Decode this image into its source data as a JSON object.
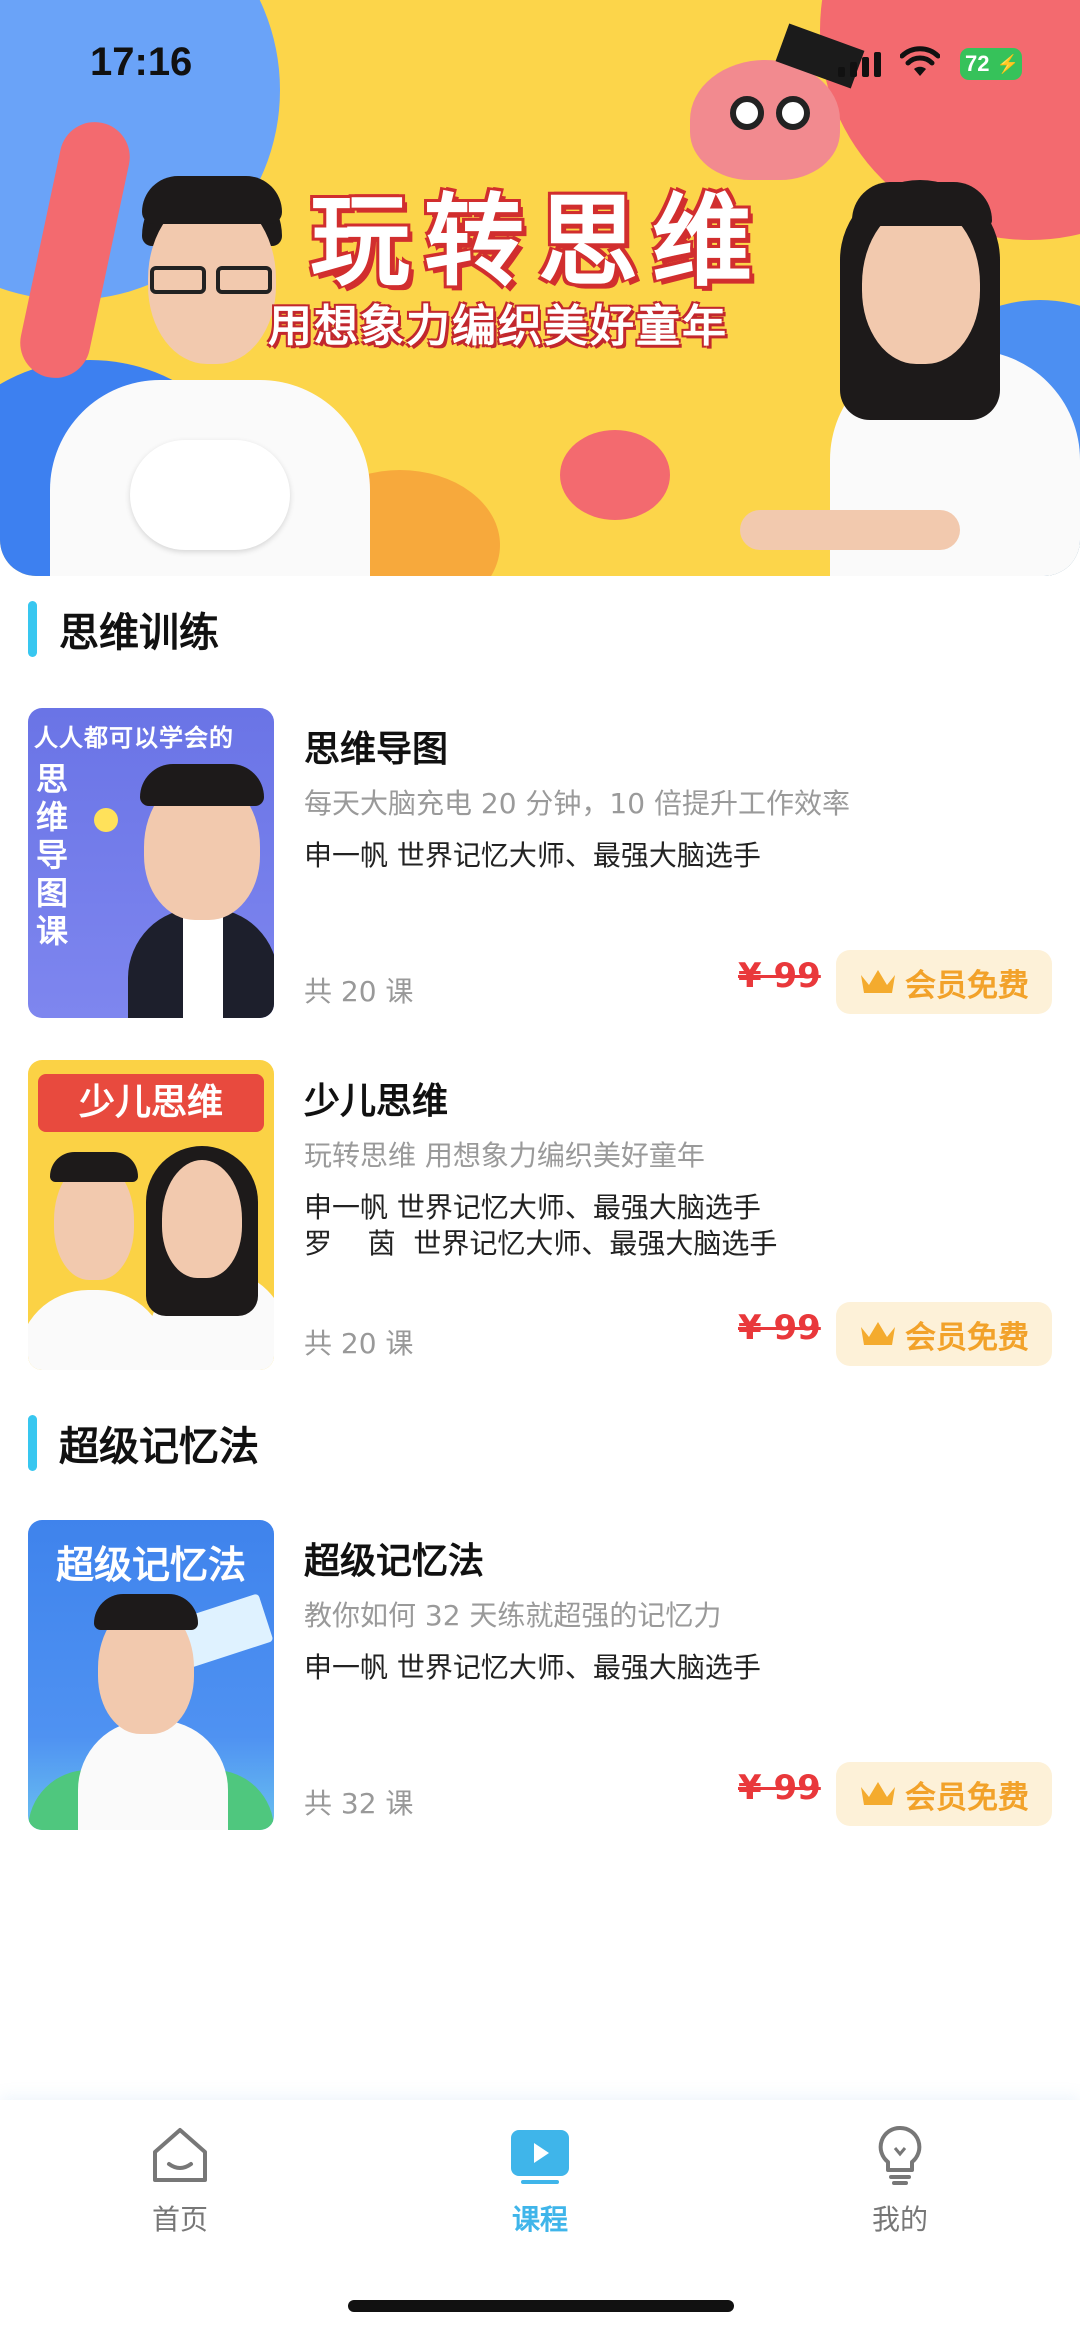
{
  "status_bar": {
    "time": "17:16",
    "battery": "72"
  },
  "banner": {
    "title": "玩转思维",
    "subtitle": "用想象力编织美好童年"
  },
  "sections": [
    {
      "title": "思维训练"
    },
    {
      "title": "超级记忆法"
    }
  ],
  "courses": [
    {
      "thumb_top": "人人都可以学会的",
      "thumb_vertical": "思维导图课",
      "title": "思维导图",
      "desc": "每天大脑充电 20 分钟，10 倍提升工作效率",
      "teachers": [
        "申一帆  世界记忆大师、最强大脑选手"
      ],
      "count": "共 20 课",
      "price": "¥ 99",
      "vip": "会员免费"
    },
    {
      "thumb_ribbon": "少儿思维",
      "title": "少儿思维",
      "desc": "玩转思维 用想象力编织美好童年",
      "teachers": [
        "申一帆  世界记忆大师、最强大脑选手",
        "罗    茵  世界记忆大师、最强大脑选手"
      ],
      "count": "共 20 课",
      "price": "¥ 99",
      "vip": "会员免费"
    },
    {
      "thumb_title": "超级记忆法",
      "title": "超级记忆法",
      "desc": "教你如何 32 天练就超强的记忆力",
      "teachers": [
        "申一帆  世界记忆大师、最强大脑选手"
      ],
      "count": "共 32 课",
      "price": "¥ 99",
      "vip": "会员免费"
    }
  ],
  "bottom_nav": [
    {
      "label": "首页",
      "icon": "home-icon",
      "active": false
    },
    {
      "label": "课程",
      "icon": "play-icon",
      "active": true
    },
    {
      "label": "我的",
      "icon": "lightbulb-icon",
      "active": false
    }
  ],
  "colors": {
    "accent": "#3fb5ea",
    "section_bar": "#38c7f0",
    "price": "#e9383b",
    "vip_text": "#f2a22a",
    "vip_bg": "#fdf1d8"
  }
}
